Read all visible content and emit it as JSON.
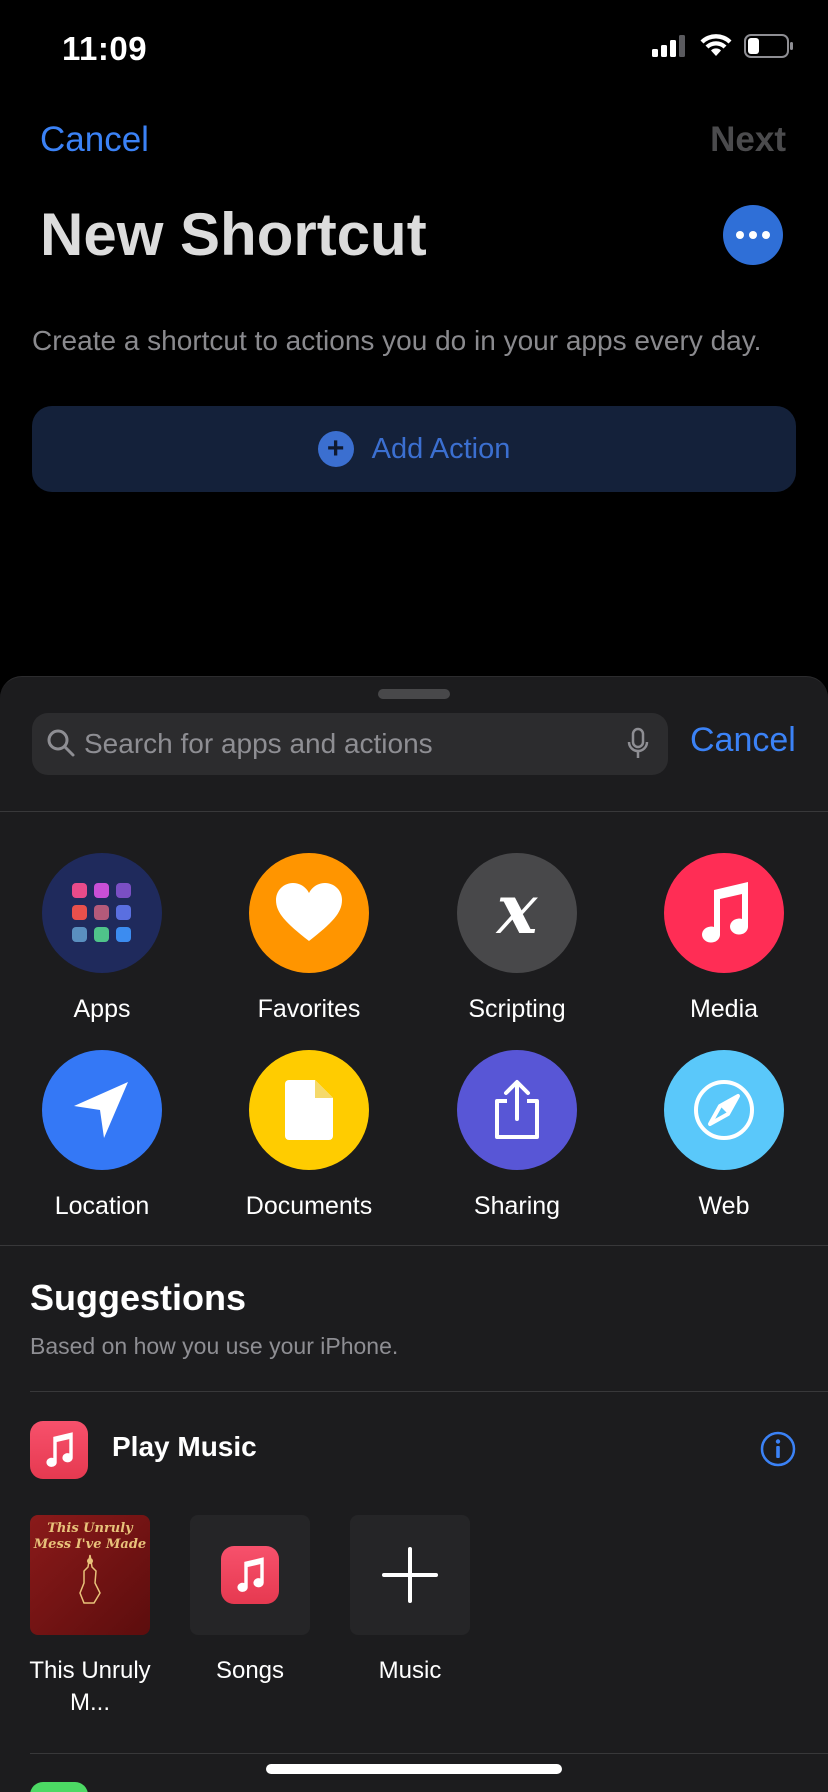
{
  "status": {
    "time": "11:09"
  },
  "nav": {
    "cancel": "Cancel",
    "next": "Next"
  },
  "page": {
    "title": "New Shortcut",
    "subtitle": "Create a shortcut to actions you do in your apps every day.",
    "add_action": "Add Action"
  },
  "sheet": {
    "search_placeholder": "Search for apps and actions",
    "cancel": "Cancel",
    "categories": [
      {
        "label": "Apps",
        "icon": "apps-grid-icon",
        "color": "#1f2a5c"
      },
      {
        "label": "Favorites",
        "icon": "heart-icon",
        "color": "#ff9500"
      },
      {
        "label": "Scripting",
        "icon": "x-variable-icon",
        "color": "#48484a"
      },
      {
        "label": "Media",
        "icon": "music-note-icon",
        "color": "#ff2d55"
      },
      {
        "label": "Location",
        "icon": "location-arrow-icon",
        "color": "#3478f6"
      },
      {
        "label": "Documents",
        "icon": "document-icon",
        "color": "#ffcc00"
      },
      {
        "label": "Sharing",
        "icon": "share-icon",
        "color": "#5856d6"
      },
      {
        "label": "Web",
        "icon": "compass-icon",
        "color": "#5ac8fa"
      }
    ],
    "suggestions": {
      "title": "Suggestions",
      "subtitle": "Based on how you use your iPhone.",
      "app_name": "Play Music",
      "album_art_text": "This Unruly Mess I've Made",
      "tiles": [
        {
          "label": "This Unruly M...",
          "icon": "album-art"
        },
        {
          "label": "Songs",
          "icon": "music-note-icon"
        },
        {
          "label": "Music",
          "icon": "plus-icon"
        }
      ]
    }
  }
}
